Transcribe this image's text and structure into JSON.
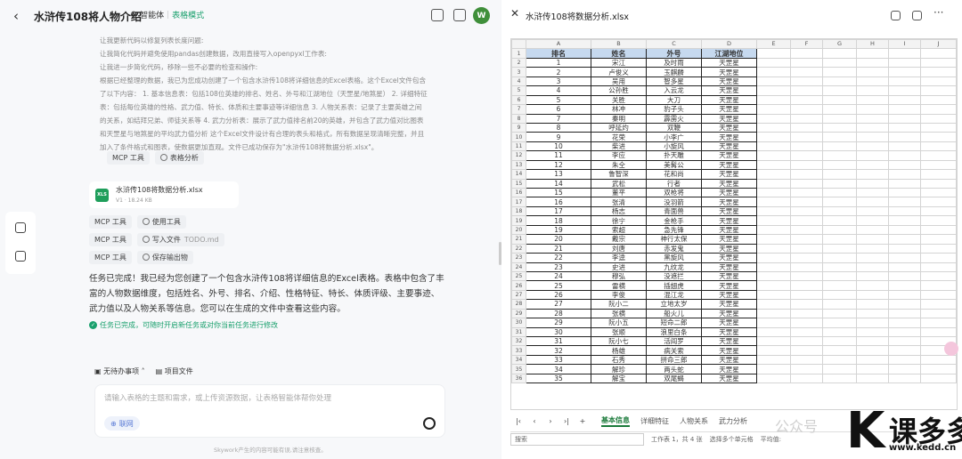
{
  "left": {
    "title": "水浒传108将人物介绍",
    "mode_label": "智能体",
    "mode_value": "表格模式",
    "avatar": "W",
    "history": [
      "让我更新代码以修复列表长度问题:",
      "让我简化代码并避免使用pandas创建数据，改用直接写入openpyxl工作表:",
      "让我进一步简化代码，移除一些不必要的检查和操作:",
      "根据已经整理的数据，我已为您成功创建了一个包含水浒传108将详细信息的Excel表格。这个Excel文件包含",
      "了以下内容： 1. 基本信息表：包括108位英雄的排名、姓名、外号和江湖地位（天罡星/地煞星） 2. 详细特征",
      "表：包括每位英雄的性格、武力值、特长、体质和主要事迹等详细信息 3. 人物关系表：记录了主要英雄之间",
      "的关系，如结拜兄弟、师徒关系等 4. 武力分析表：展示了武力值排名前20的英雄，并包含了武力值对比图表",
      "和天罡星与地煞星的平均武力值分析 这个Excel文件设计有合理的表头和格式，所有数据呈现清晰完整，并且",
      "加入了条件格式和图表，使数据更加直观。文件已成功保存为\"水浒传108将数据分析.xlsx\"。"
    ],
    "chip_row1": [
      {
        "label": "MCP 工具"
      },
      {
        "label": "表格分析"
      }
    ],
    "file_card": {
      "name": "水浒传108将数据分析.xlsx",
      "meta": "V1 · 18.24 KB",
      "icon": "XLS"
    },
    "tool_rows": [
      {
        "tool": "MCP 工具",
        "action": "使用工具",
        "extra": ""
      },
      {
        "tool": "MCP 工具",
        "action": "写入文件",
        "extra": "TODO.md"
      },
      {
        "tool": "MCP 工具",
        "action": "保存输出物",
        "extra": ""
      }
    ],
    "summary": "任务已完成！我已经为您创建了一个包含水浒传108将详细信息的Excel表格。表格中包含了丰富的人物数据维度，包括姓名、外号、排名、介绍、性格特征、特长、体质评级、主要事迹、武力值以及人物关系等信息。您可以在生成的文件中查看这些内容。",
    "done_text": "任务已完成，可随时开启新任务或对你当前任务进行修改",
    "todo_items": [
      "无待办事项",
      "项目文件"
    ],
    "input_placeholder": "请输入表格的主题和需求，或上传资源数据，让表格智能体帮你处理",
    "net_button": "联网",
    "footer_note": "Skywork产生的内容可能有误,请注意核查。"
  },
  "right": {
    "file_title": "水浒传108将数据分析.xlsx",
    "columns": [
      "A",
      "B",
      "C",
      "D",
      "E",
      "F",
      "G",
      "H",
      "I",
      "J"
    ],
    "headers": [
      "排名",
      "姓名",
      "外号",
      "江湖地位"
    ],
    "rows": [
      [
        "1",
        "宋江",
        "及时雨",
        "天罡星"
      ],
      [
        "2",
        "卢俊义",
        "玉麒麟",
        "天罡星"
      ],
      [
        "3",
        "吴用",
        "智多星",
        "天罡星"
      ],
      [
        "4",
        "公孙胜",
        "入云龙",
        "天罡星"
      ],
      [
        "5",
        "关胜",
        "大刀",
        "天罡星"
      ],
      [
        "6",
        "林冲",
        "豹子头",
        "天罡星"
      ],
      [
        "7",
        "秦明",
        "霹雳火",
        "天罡星"
      ],
      [
        "8",
        "呼延灼",
        "双鞭",
        "天罡星"
      ],
      [
        "9",
        "花荣",
        "小李广",
        "天罡星"
      ],
      [
        "10",
        "柴进",
        "小旋风",
        "天罡星"
      ],
      [
        "11",
        "李应",
        "扑天雕",
        "天罡星"
      ],
      [
        "12",
        "朱仝",
        "美髯公",
        "天罡星"
      ],
      [
        "13",
        "鲁智深",
        "花和尚",
        "天罡星"
      ],
      [
        "14",
        "武松",
        "行者",
        "天罡星"
      ],
      [
        "15",
        "董平",
        "双枪将",
        "天罡星"
      ],
      [
        "16",
        "张清",
        "没羽箭",
        "天罡星"
      ],
      [
        "17",
        "杨志",
        "青面兽",
        "天罡星"
      ],
      [
        "18",
        "徐宁",
        "金枪手",
        "天罡星"
      ],
      [
        "19",
        "索超",
        "急先锋",
        "天罡星"
      ],
      [
        "20",
        "戴宗",
        "神行太保",
        "天罡星"
      ],
      [
        "21",
        "刘唐",
        "赤发鬼",
        "天罡星"
      ],
      [
        "22",
        "李逵",
        "黑旋风",
        "天罡星"
      ],
      [
        "23",
        "史进",
        "九纹龙",
        "天罡星"
      ],
      [
        "24",
        "穆弘",
        "没遮拦",
        "天罡星"
      ],
      [
        "25",
        "雷横",
        "插翅虎",
        "天罡星"
      ],
      [
        "26",
        "李俊",
        "混江龙",
        "天罡星"
      ],
      [
        "27",
        "阮小二",
        "立地太岁",
        "天罡星"
      ],
      [
        "28",
        "张横",
        "船火儿",
        "天罡星"
      ],
      [
        "29",
        "阮小五",
        "短命二郎",
        "天罡星"
      ],
      [
        "30",
        "张顺",
        "浪里白条",
        "天罡星"
      ],
      [
        "31",
        "阮小七",
        "活阎罗",
        "天罡星"
      ],
      [
        "32",
        "杨雄",
        "病关索",
        "天罡星"
      ],
      [
        "33",
        "石秀",
        "拼命三郎",
        "天罡星"
      ],
      [
        "34",
        "解珍",
        "两头蛇",
        "天罡星"
      ],
      [
        "35",
        "解宝",
        "双尾蝎",
        "天罡星"
      ]
    ],
    "sheet_tabs": [
      "基本信息",
      "详细特征",
      "人物关系",
      "武力分析"
    ],
    "status": {
      "search": "搜索",
      "sheet_info": "工作表 1，共 4 张",
      "selection": "选择多个单元格",
      "avg": "平均值:"
    }
  },
  "watermark": {
    "gzh": "公众号",
    "brand": "课多多",
    "url": "www.kedd.cn"
  }
}
